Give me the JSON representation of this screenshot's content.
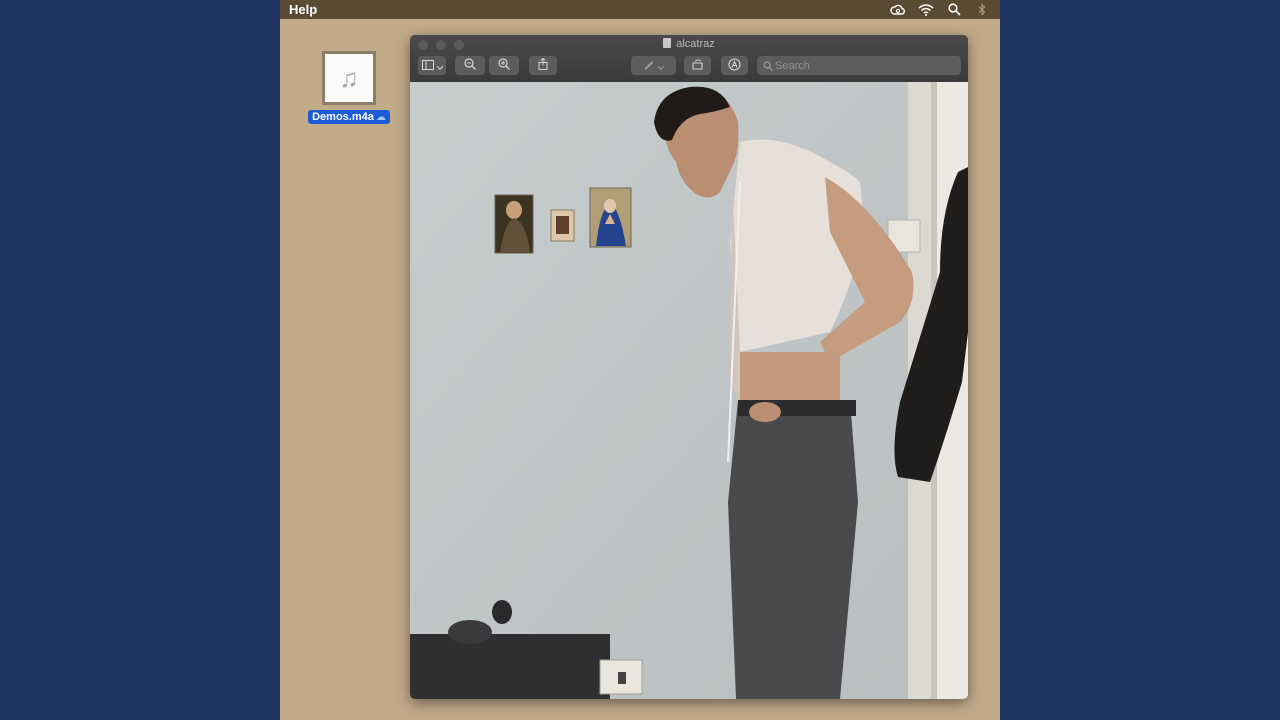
{
  "menubar": {
    "app_menu": "Help",
    "icons": [
      "creative-cloud-icon",
      "wifi-icon",
      "search-icon",
      "bluetooth-icon"
    ]
  },
  "desktop": {
    "file": {
      "name": "Demos.m4a",
      "icon": "music-note-icon",
      "badge_icon": "icloud-download-icon"
    }
  },
  "preview_window": {
    "title": "alcatraz",
    "toolbar": {
      "sidebar_button": "sidebar-icon",
      "zoom_out": "zoom-out-icon",
      "zoom_in": "zoom-in-icon",
      "share": "share-icon",
      "markup": "pen-icon",
      "rotate": "rotate-icon",
      "annotate": "markup-icon"
    },
    "search": {
      "placeholder": "Search",
      "value": ""
    }
  },
  "colors": {
    "background": "#1f345e",
    "desktop": "#c2ab89",
    "menubar": "#5a4a33",
    "selection": "#1e5bd6",
    "window_chrome": "#3c3c3c"
  }
}
